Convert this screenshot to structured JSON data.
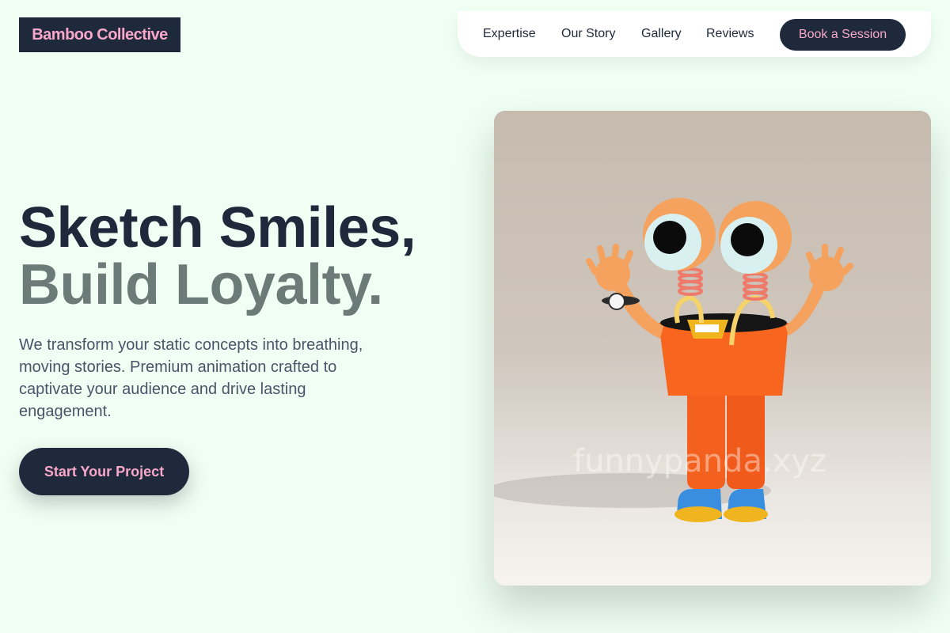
{
  "brand": {
    "name": "Bamboo Collective"
  },
  "nav": {
    "links": [
      "Expertise",
      "Our Story",
      "Gallery",
      "Reviews"
    ],
    "cta_label": "Book a Session"
  },
  "hero": {
    "title_line1": "Sketch Smiles,",
    "title_line2": "Build Loyalty.",
    "description": "We transform your static concepts into breathing, moving stories. Premium animation crafted to captivate your audience and drive lasting engagement.",
    "cta_label": "Start Your Project",
    "image_watermark": "funnypanda.xyz",
    "image_subject": "orange-cartoon-character-with-spring-eyes"
  },
  "colors": {
    "background": "#f0fff3",
    "primary_dark": "#1e293b",
    "accent_pink": "#f9a8c9",
    "title_muted": "#6b7b78",
    "body_text": "#475569"
  }
}
